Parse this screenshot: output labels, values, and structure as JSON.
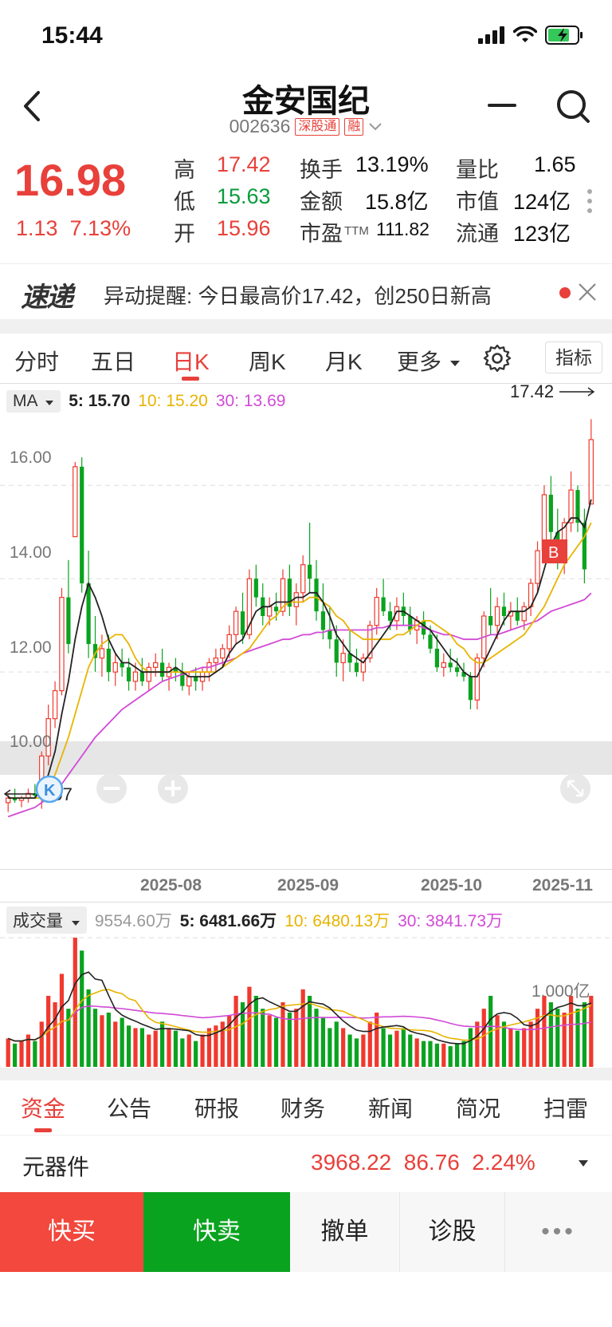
{
  "status_bar": {
    "time": "15:44"
  },
  "header": {
    "name": "金安国纪",
    "code": "002636",
    "tag_market": "深股通",
    "tag_margin": "融"
  },
  "quote": {
    "price": "16.98",
    "change": "1.13",
    "change_pct": "7.13%",
    "high_label": "高",
    "high": "17.42",
    "low_label": "低",
    "low": "15.63",
    "open_label": "开",
    "open": "15.96",
    "turnover_label": "换手",
    "turnover": "13.19%",
    "amount_label": "金额",
    "amount": "15.8亿",
    "pe_label": "市盈",
    "pe_sub": "TTM",
    "pe": "111.82",
    "vol_ratio_label": "量比",
    "vol_ratio": "1.65",
    "mktcap_label": "市值",
    "mktcap": "124亿",
    "float_label": "流通",
    "float": "123亿"
  },
  "alert": {
    "logo": "速递",
    "text": "异动提醒: 今日最高价17.42，创250日新高"
  },
  "tabs": {
    "t1": "分时",
    "t2": "五日",
    "t3": "日K",
    "t4": "周K",
    "t5": "月K",
    "t6": "更多",
    "indicator": "指标"
  },
  "ma_legend": {
    "selector": "MA",
    "ma5": "5: 15.70",
    "ma10": "10: 15.20",
    "ma30": "30: 13.69"
  },
  "chart_labels": {
    "y_16": "16.00",
    "y_14": "14.00",
    "y_12": "12.00",
    "y_10": "10.00",
    "high_marker": "17.42",
    "low_marker": "9.07",
    "buy_marker": "B",
    "k_marker": "K"
  },
  "date_axis": {
    "d1": "2025-08",
    "d2": "2025-09",
    "d3": "2025-10",
    "d4": "2025-11"
  },
  "volume_legend": {
    "selector": "成交量",
    "total": "9554.60万",
    "ma5": "5: 6481.66万",
    "ma10": "10: 6480.13万",
    "ma30": "30: 3841.73万",
    "scale": "1.000亿"
  },
  "bottom_tabs": {
    "b1": "资金",
    "b2": "公告",
    "b3": "研报",
    "b4": "财务",
    "b5": "新闻",
    "b6": "简况",
    "b7": "扫雷"
  },
  "sector": {
    "name": "元器件",
    "index": "3968.22",
    "change": "86.76",
    "change_pct": "2.24%"
  },
  "actions": {
    "buy": "快买",
    "sell": "快卖",
    "cancel": "撤单",
    "diagnose": "诊股",
    "more": "•••"
  },
  "chart_data": {
    "type": "candlestick",
    "ylim": [
      8.6,
      17.8
    ],
    "y_ticks": [
      10,
      12,
      14,
      16
    ],
    "x_ticks": [
      "2025-08",
      "2025-09",
      "2025-10",
      "2025-11"
    ],
    "candles": [
      [
        9.2,
        9.4,
        9.0,
        9.3
      ],
      [
        9.3,
        9.5,
        9.2,
        9.25
      ],
      [
        9.25,
        9.35,
        9.1,
        9.3
      ],
      [
        9.3,
        9.5,
        9.2,
        9.4
      ],
      [
        9.4,
        9.6,
        9.3,
        9.35
      ],
      [
        9.35,
        10.3,
        9.07,
        10.2
      ],
      [
        10.2,
        11.3,
        10.0,
        11.0
      ],
      [
        11.0,
        11.8,
        10.8,
        11.6
      ],
      [
        11.6,
        13.8,
        11.5,
        13.6
      ],
      [
        13.6,
        14.4,
        12.4,
        12.6
      ],
      [
        14.9,
        16.5,
        14.9,
        16.4
      ],
      [
        16.4,
        16.6,
        13.7,
        13.9
      ],
      [
        13.9,
        14.6,
        12.3,
        12.6
      ],
      [
        12.6,
        13.2,
        12.0,
        12.3
      ],
      [
        12.3,
        12.8,
        11.9,
        12.5
      ],
      [
        12.5,
        12.8,
        11.8,
        12.0
      ],
      [
        12.0,
        12.4,
        11.7,
        12.2
      ],
      [
        12.2,
        12.5,
        11.9,
        12.1
      ],
      [
        12.1,
        12.3,
        11.6,
        11.8
      ],
      [
        11.8,
        12.2,
        11.6,
        12.0
      ],
      [
        12.0,
        12.3,
        11.7,
        11.8
      ],
      [
        11.8,
        12.2,
        11.6,
        12.1
      ],
      [
        12.1,
        12.4,
        11.9,
        12.2
      ],
      [
        12.2,
        12.5,
        11.8,
        11.9
      ],
      [
        11.9,
        12.2,
        11.6,
        12.1
      ],
      [
        12.1,
        12.3,
        11.8,
        12.0
      ],
      [
        12.0,
        12.2,
        11.6,
        11.7
      ],
      [
        11.7,
        12.0,
        11.5,
        11.9
      ],
      [
        11.9,
        12.1,
        11.6,
        11.8
      ],
      [
        11.8,
        12.1,
        11.6,
        12.0
      ],
      [
        12.0,
        12.3,
        11.8,
        12.2
      ],
      [
        12.2,
        12.5,
        12.0,
        12.3
      ],
      [
        12.3,
        12.6,
        12.1,
        12.5
      ],
      [
        12.5,
        13.0,
        12.3,
        12.8
      ],
      [
        12.8,
        13.4,
        12.6,
        13.3
      ],
      [
        13.3,
        13.7,
        12.6,
        12.8
      ],
      [
        12.8,
        14.2,
        12.7,
        14.0
      ],
      [
        14.0,
        14.3,
        13.4,
        13.6
      ],
      [
        13.6,
        13.9,
        13.0,
        13.2
      ],
      [
        13.2,
        13.6,
        13.0,
        13.4
      ],
      [
        13.4,
        13.7,
        13.1,
        13.3
      ],
      [
        13.3,
        14.2,
        13.2,
        14.0
      ],
      [
        14.0,
        14.3,
        13.2,
        13.4
      ],
      [
        13.4,
        13.9,
        13.0,
        13.7
      ],
      [
        13.7,
        14.5,
        13.5,
        14.3
      ],
      [
        14.3,
        15.2,
        13.7,
        14.0
      ],
      [
        14.0,
        14.4,
        13.1,
        13.3
      ],
      [
        13.3,
        13.9,
        12.7,
        12.9
      ],
      [
        12.9,
        13.4,
        12.5,
        12.7
      ],
      [
        12.7,
        13.0,
        11.9,
        12.2
      ],
      [
        12.2,
        12.7,
        11.8,
        12.4
      ],
      [
        12.4,
        12.9,
        12.0,
        12.2
      ],
      [
        12.2,
        12.5,
        11.9,
        12.0
      ],
      [
        12.0,
        12.4,
        11.8,
        12.3
      ],
      [
        12.3,
        13.1,
        12.2,
        13.0
      ],
      [
        13.0,
        13.8,
        12.8,
        13.6
      ],
      [
        13.6,
        14.0,
        13.2,
        13.3
      ],
      [
        13.3,
        13.5,
        12.9,
        13.1
      ],
      [
        13.1,
        13.6,
        12.9,
        13.4
      ],
      [
        13.4,
        13.7,
        13.0,
        13.2
      ],
      [
        13.2,
        13.4,
        12.8,
        12.9
      ],
      [
        12.9,
        13.2,
        12.6,
        13.1
      ],
      [
        13.1,
        13.3,
        12.7,
        12.8
      ],
      [
        12.8,
        13.0,
        12.4,
        12.5
      ],
      [
        12.5,
        12.8,
        12.0,
        12.1
      ],
      [
        12.1,
        12.4,
        11.9,
        12.2
      ],
      [
        12.2,
        12.5,
        12.0,
        12.1
      ],
      [
        12.1,
        12.3,
        11.9,
        12.0
      ],
      [
        12.0,
        12.2,
        11.8,
        11.9
      ],
      [
        11.9,
        12.0,
        11.2,
        11.4
      ],
      [
        11.4,
        12.4,
        11.2,
        12.3
      ],
      [
        12.3,
        13.3,
        12.1,
        13.2
      ],
      [
        13.2,
        13.8,
        12.8,
        13.0
      ],
      [
        13.0,
        13.6,
        12.7,
        13.4
      ],
      [
        13.4,
        13.7,
        13.0,
        13.2
      ],
      [
        13.2,
        13.5,
        12.9,
        13.3
      ],
      [
        13.3,
        13.6,
        13.0,
        13.1
      ],
      [
        13.1,
        13.5,
        12.9,
        13.4
      ],
      [
        13.4,
        14.0,
        13.2,
        13.9
      ],
      [
        13.9,
        14.8,
        13.7,
        14.6
      ],
      [
        14.6,
        16.0,
        14.5,
        15.8
      ],
      [
        15.8,
        16.2,
        14.8,
        15.0
      ],
      [
        15.0,
        15.5,
        14.2,
        14.5
      ],
      [
        14.5,
        15.3,
        14.1,
        15.2
      ],
      [
        15.2,
        16.3,
        15.0,
        15.9
      ],
      [
        15.9,
        16.0,
        15.0,
        15.2
      ],
      [
        15.2,
        15.5,
        13.9,
        14.2
      ],
      [
        15.6,
        17.42,
        15.63,
        16.98
      ]
    ],
    "ma5": [
      9.3,
      9.3,
      9.3,
      9.3,
      9.3,
      9.5,
      9.8,
      10.3,
      11.1,
      11.8,
      12.7,
      13.4,
      13.9,
      13.6,
      13.2,
      12.7,
      12.4,
      12.2,
      12.2,
      12.1,
      12.0,
      12.0,
      12.0,
      12.0,
      12.0,
      12.1,
      12.0,
      11.9,
      11.9,
      11.9,
      11.9,
      12.0,
      12.1,
      12.4,
      12.6,
      12.7,
      13.0,
      13.3,
      13.4,
      13.4,
      13.5,
      13.5,
      13.5,
      13.6,
      13.6,
      13.7,
      13.7,
      13.5,
      13.2,
      12.8,
      12.6,
      12.4,
      12.3,
      12.2,
      12.4,
      12.6,
      12.8,
      13.0,
      13.3,
      13.3,
      13.2,
      13.1,
      13.0,
      12.9,
      12.7,
      12.5,
      12.3,
      12.2,
      12.0,
      11.9,
      11.9,
      12.2,
      12.5,
      12.8,
      13.1,
      13.3,
      13.3,
      13.3,
      13.4,
      13.7,
      14.2,
      14.7,
      15.0,
      15.1,
      15.3,
      15.3,
      15.1,
      15.7
    ],
    "ma10": [
      9.3,
      9.3,
      9.3,
      9.3,
      9.3,
      9.3,
      9.5,
      9.8,
      10.2,
      10.6,
      11.1,
      11.6,
      12.1,
      12.4,
      12.6,
      12.7,
      12.8,
      12.8,
      12.6,
      12.3,
      12.1,
      12.0,
      12.0,
      12.0,
      12.0,
      12.0,
      12.0,
      12.0,
      12.0,
      12.0,
      12.0,
      12.0,
      12.1,
      12.2,
      12.3,
      12.4,
      12.5,
      12.7,
      12.9,
      13.1,
      13.2,
      13.4,
      13.5,
      13.5,
      13.5,
      13.6,
      13.6,
      13.5,
      13.4,
      13.2,
      13.1,
      12.9,
      12.8,
      12.7,
      12.7,
      12.7,
      12.7,
      12.7,
      12.8,
      12.8,
      12.9,
      13.0,
      13.1,
      13.1,
      13.0,
      12.9,
      12.8,
      12.6,
      12.5,
      12.3,
      12.2,
      12.2,
      12.3,
      12.4,
      12.5,
      12.6,
      12.7,
      12.8,
      13.0,
      13.2,
      13.4,
      13.7,
      14.0,
      14.3,
      14.5,
      14.7,
      14.9,
      15.2
    ],
    "ma30": [
      8.9,
      8.95,
      9.0,
      9.05,
      9.1,
      9.2,
      9.3,
      9.45,
      9.6,
      9.8,
      10.0,
      10.2,
      10.4,
      10.6,
      10.75,
      10.9,
      11.05,
      11.2,
      11.3,
      11.4,
      11.5,
      11.6,
      11.7,
      11.8,
      11.85,
      11.9,
      11.95,
      12.0,
      12.05,
      12.1,
      12.1,
      12.15,
      12.2,
      12.25,
      12.3,
      12.4,
      12.45,
      12.5,
      12.55,
      12.6,
      12.65,
      12.7,
      12.7,
      12.75,
      12.8,
      12.8,
      12.85,
      12.85,
      12.9,
      12.9,
      12.9,
      12.9,
      12.9,
      12.9,
      12.9,
      12.95,
      12.95,
      13.0,
      13.0,
      13.0,
      13.0,
      13.0,
      12.95,
      12.9,
      12.85,
      12.8,
      12.8,
      12.75,
      12.7,
      12.7,
      12.7,
      12.75,
      12.8,
      12.8,
      12.85,
      12.9,
      12.95,
      13.0,
      13.05,
      13.1,
      13.2,
      13.3,
      13.35,
      13.4,
      13.45,
      13.5,
      13.55,
      13.69
    ],
    "volume": [
      0.22,
      0.18,
      0.2,
      0.25,
      0.2,
      0.35,
      0.55,
      0.5,
      0.72,
      0.45,
      1.0,
      0.9,
      0.6,
      0.45,
      0.4,
      0.42,
      0.35,
      0.38,
      0.32,
      0.3,
      0.3,
      0.25,
      0.28,
      0.35,
      0.3,
      0.28,
      0.22,
      0.25,
      0.2,
      0.25,
      0.3,
      0.32,
      0.35,
      0.4,
      0.55,
      0.5,
      0.62,
      0.55,
      0.45,
      0.4,
      0.38,
      0.5,
      0.42,
      0.45,
      0.6,
      0.55,
      0.45,
      0.38,
      0.3,
      0.35,
      0.3,
      0.25,
      0.22,
      0.25,
      0.35,
      0.42,
      0.3,
      0.25,
      0.28,
      0.3,
      0.25,
      0.22,
      0.2,
      0.2,
      0.18,
      0.18,
      0.16,
      0.18,
      0.2,
      0.3,
      0.35,
      0.45,
      0.55,
      0.4,
      0.35,
      0.3,
      0.28,
      0.3,
      0.35,
      0.45,
      0.55,
      0.5,
      0.45,
      0.42,
      0.55,
      0.45,
      0.5,
      0.55
    ],
    "volume_unit": "亿"
  }
}
